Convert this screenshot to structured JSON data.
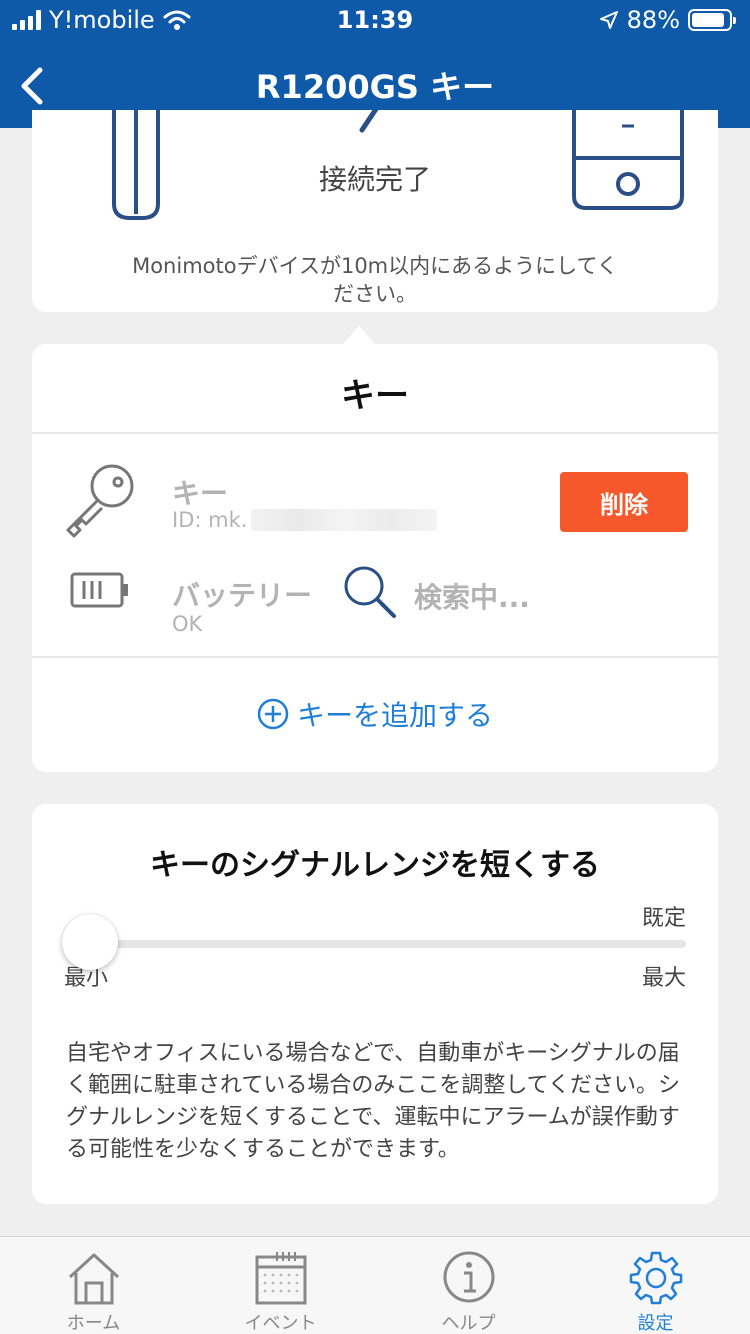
{
  "status_bar": {
    "carrier": "Y!mobile",
    "time": "11:39",
    "battery_text": "88%",
    "battery_level": 0.88
  },
  "nav": {
    "title": "R1200GS キー",
    "back_icon": "chevron-left-icon"
  },
  "connection": {
    "status": "接続完了",
    "hint": "Monimotoデバイスが10m以内にあるようにしてください。"
  },
  "key_section": {
    "title": "キー",
    "key_label": "キー",
    "key_id": "ID: mk.",
    "delete_label": "削除",
    "battery_label": "バッテリー",
    "battery_status": "OK",
    "search_status": "検索中...",
    "add_key_label": "キーを追加する"
  },
  "range_section": {
    "title": "キーのシグナルレンジを短くする",
    "default_label": "既定",
    "min_label": "最小",
    "max_label": "最大",
    "slider_value": 0,
    "description": "自宅やオフィスにいる場合などで、自動車がキーシグナルの届く範囲に駐車されている場合のみここを調整してください。シグナルレンジを短くすることで、運転中にアラームが誤作動する可能性を少なくすることができます。"
  },
  "tabs": [
    {
      "label": "ホーム",
      "icon": "home-icon"
    },
    {
      "label": "イベント",
      "icon": "calendar-icon"
    },
    {
      "label": "ヘルプ",
      "icon": "info-icon"
    },
    {
      "label": "設定",
      "icon": "gear-icon"
    }
  ],
  "colors": {
    "brand_blue": "#0f5aa8",
    "accent_blue": "#1f7fd8",
    "delete_orange": "#f6582b"
  }
}
